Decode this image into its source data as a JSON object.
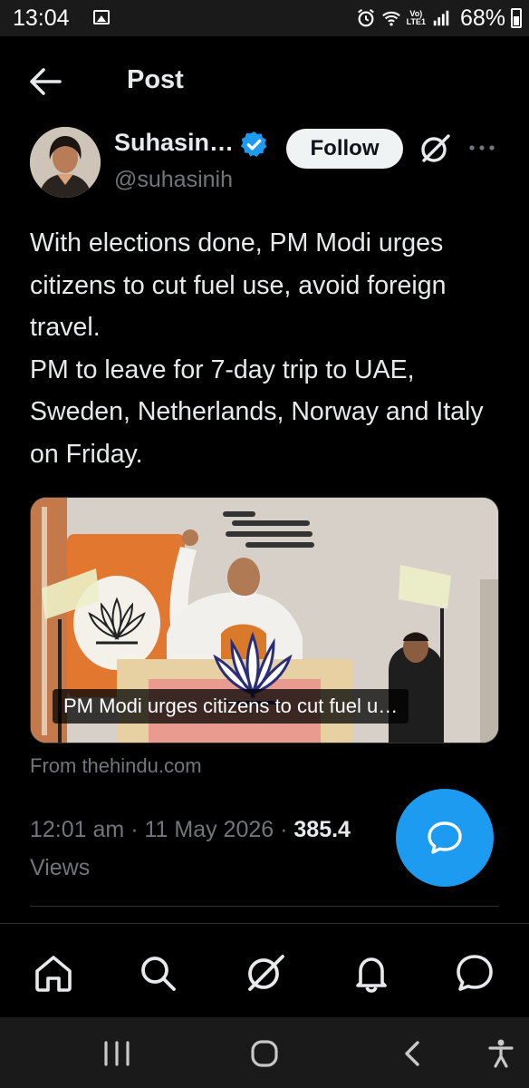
{
  "status_bar": {
    "time": "13:04",
    "network_label_top": "Vo)",
    "network_label_bottom": "LTE1",
    "battery": "68%",
    "icons": [
      "image-icon",
      "alarm-icon",
      "wifi-icon",
      "signal-icon",
      "battery-icon"
    ]
  },
  "header": {
    "title": "Post",
    "back_icon": "arrow-left-icon"
  },
  "author": {
    "name": "Suhasin…",
    "handle": "@suhasinih",
    "verified": true,
    "follow_label": "Follow"
  },
  "post": {
    "lines": [
      "With elections done, PM Modi urges citizens to cut fuel use, avoid foreign travel.",
      "PM to leave for 7-day trip to UAE, Sweden, Netherlands, Norway and Italy on Friday."
    ]
  },
  "card": {
    "caption": "PM Modi urges citizens to cut fuel u…",
    "source": "From thehindu.com"
  },
  "meta": {
    "time": "12:01 am",
    "separator": " · ",
    "date": "11 May 2026",
    "views_count": "385.4",
    "views_label": "Views"
  },
  "bottom_nav": {
    "items": [
      "home-icon",
      "search-icon",
      "grok-icon",
      "notifications-icon",
      "messages-icon"
    ]
  },
  "system_nav": {
    "items": [
      "recent-apps-icon",
      "home-circle-icon",
      "back-chevron-icon",
      "accessibility-icon"
    ]
  },
  "colors": {
    "background": "#000000",
    "text_primary": "#e7e9ea",
    "text_secondary": "#71767b",
    "accent": "#1d9bf0",
    "follow_bg": "#eff3f4",
    "system_bar": "#1a1a1a"
  }
}
